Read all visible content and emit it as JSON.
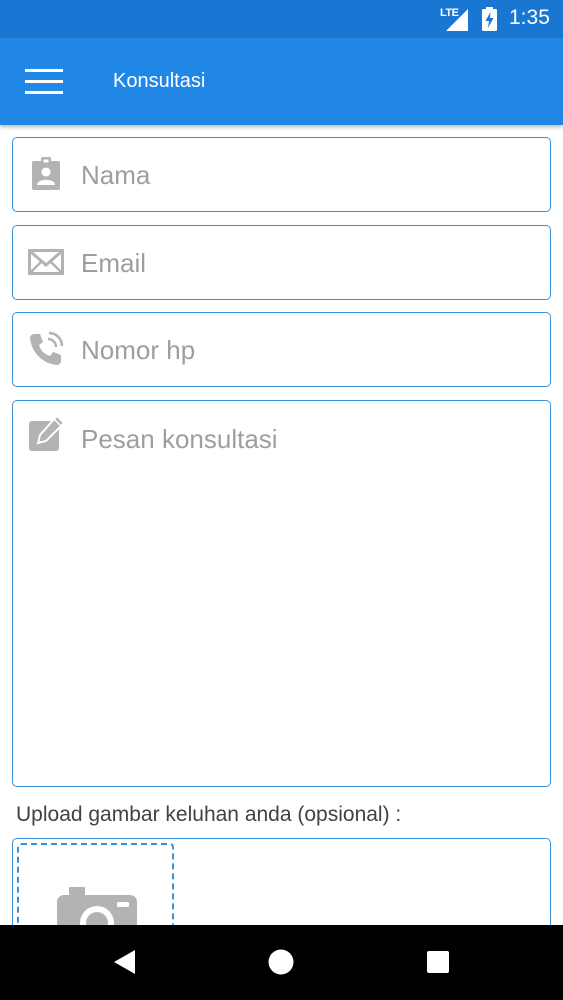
{
  "status_bar": {
    "network": "LTE",
    "time": "1:35"
  },
  "app_bar": {
    "title": "Konsultasi",
    "menu_icon": "hamburger-menu-icon"
  },
  "form": {
    "name": {
      "placeholder": "Nama",
      "value": "",
      "icon": "contact-badge-icon"
    },
    "email": {
      "placeholder": "Email",
      "value": "",
      "icon": "envelope-icon"
    },
    "phone": {
      "placeholder": "Nomor hp",
      "value": "",
      "icon": "phone-icon"
    },
    "message": {
      "placeholder": "Pesan konsultasi",
      "value": "",
      "icon": "edit-icon"
    },
    "upload": {
      "label": "Upload gambar keluhan anda (opsional) :",
      "icon": "camera-icon"
    }
  },
  "nav_bar": {
    "icons": [
      "back-icon",
      "home-icon",
      "recents-icon"
    ]
  },
  "colors": {
    "status_bar": "#1976d2",
    "app_bar": "#2187e7",
    "field_border": "#3a91d8",
    "placeholder": "#9e9e9e",
    "icon_gray": "#b3b3b3"
  }
}
